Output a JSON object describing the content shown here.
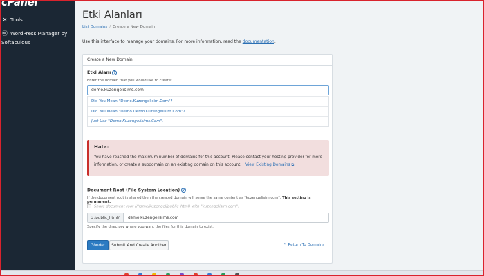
{
  "sidebar": {
    "logo": "cPanel",
    "items": [
      {
        "icon": "tools-icon",
        "label": "Tools"
      },
      {
        "icon": "wordpress-icon",
        "label": "WordPress Manager by"
      },
      {
        "icon": "",
        "label": "Softaculous"
      }
    ]
  },
  "header": {
    "title": "Etki Alanları",
    "breadcrumb": {
      "link": "List Domains",
      "current": "Create a New Domain"
    },
    "intro": "Use this interface to manage your domains. For more information, read the",
    "intro_link": "documentation",
    "intro_end": "."
  },
  "panel": {
    "title": "Create a New Domain",
    "domain_label": "Etki Alanı",
    "domain_help": "Enter the domain that you would like to create:",
    "domain_value": "demo.kuzengelisims.com",
    "suggestions": [
      "Did You Mean \"Demo.Kuzengelisim.Com\"?",
      "Did You Mean \"Demo.Demo.Kuzengelisim.Com\"?",
      "Just Use \"Demo.Kuzengelisims.Com\"."
    ],
    "error": {
      "title": "Hata:",
      "text": "You have reached the maximum number of domains for this account. Please contact your hosting provider for more information, or create a subdomain on an existing domain on this account.",
      "link": "View Existing Domains"
    },
    "docroot": {
      "label": "Document Root (File System Location)",
      "help": "If the document root is shared then the created domain will serve the same content as \"kuzengelisim.com\".",
      "help_bold": "This setting is permanent.",
      "share_label": "Share document root (/home/kuzengel/public_html) with \"kuzengelisim.com\".",
      "prefix": "/public_html/",
      "value": "demo.kuzengelisims.com",
      "note": "Specify the directory where you want the files for this domain to exist."
    },
    "buttons": {
      "submit": "Gönder",
      "submit_another": "Submit And Create Another",
      "return": "Return To Domains"
    }
  },
  "colors": {
    "sidebar_bg": "#1b2734",
    "accent": "#2c7bc2",
    "error_bg": "#f2dede",
    "error_border": "#c9302c",
    "frame": "#d9232d"
  }
}
